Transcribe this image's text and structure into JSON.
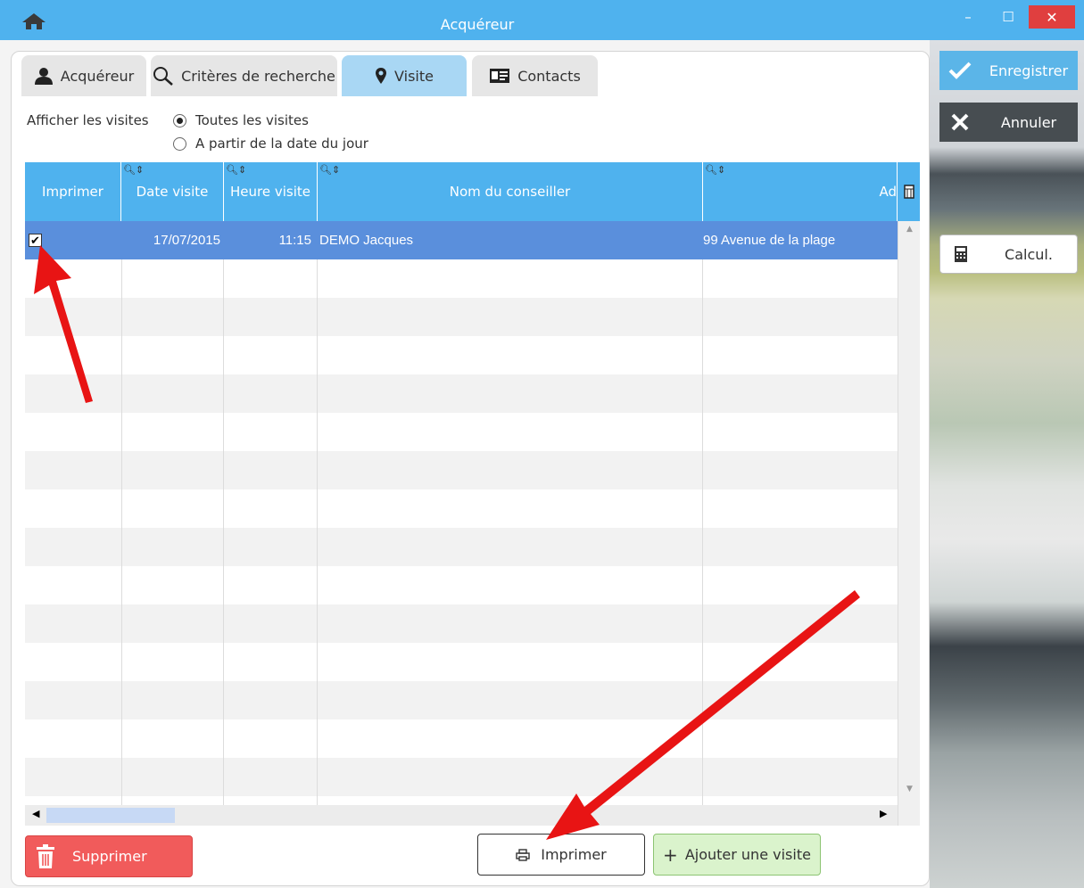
{
  "window": {
    "title": "Acquéreur",
    "minimize": "–",
    "maximize": "☐",
    "close": "✕"
  },
  "tabs": [
    {
      "label": "Acquéreur",
      "icon": "person-icon",
      "active": false
    },
    {
      "label": "Critères de recherche",
      "icon": "search-icon",
      "active": false
    },
    {
      "label": "Visite",
      "icon": "map-pin-icon",
      "active": true
    },
    {
      "label": "Contacts",
      "icon": "contact-card-icon",
      "active": false
    }
  ],
  "filter": {
    "label": "Afficher les visites",
    "options": [
      {
        "label": "Toutes les visites",
        "selected": true
      },
      {
        "label": "A partir de la date du jour",
        "selected": false
      }
    ]
  },
  "table": {
    "columns": [
      "Imprimer",
      "Date visite",
      "Heure visite",
      "Nom du conseiller",
      "Ad"
    ],
    "rows": [
      {
        "imprimer": true,
        "date": "17/07/2015",
        "heure": "11:15",
        "conseiller": "DEMO Jacques",
        "adresse": "99 Avenue de la plage"
      }
    ]
  },
  "side": {
    "save_label": "Enregistrer",
    "cancel_label": "Annuler",
    "calc_label": "Calcul."
  },
  "buttons": {
    "delete_label": "Supprimer",
    "print_label": "Imprimer",
    "add_label": "Ajouter une visite"
  },
  "colors": {
    "accent": "#4fb2ee",
    "selected_row": "#5a8fdc",
    "delete": "#f15b5b",
    "add": "#daf3cc",
    "arrow": "#e81414"
  }
}
